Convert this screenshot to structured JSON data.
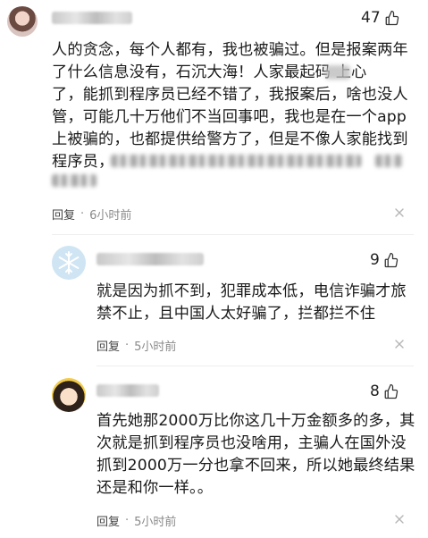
{
  "comments": [
    {
      "likes": "47",
      "lines": [
        "人的贪念，每个人都有，我也被骗过。但是报案两年",
        "了什么信息没有，石沉大海！人家最起码   上心",
        "了，能抓到程序员已经不错了，我报案后，啥也没人",
        "管，可能几十万他们不当回事吧，我也是在一个app",
        "上被骗的，也都提供给警方了，但是不像人家能找到",
        "程序员，"
      ],
      "reply_label": "回复",
      "time": "6小时前"
    },
    {
      "likes": "9",
      "lines": [
        "就是因为抓不到，犯罪成本低，电信诈骗才旅",
        "禁不止，且中国人太好骗了，拦都拦不住"
      ],
      "reply_label": "回复",
      "time": "5小时前"
    },
    {
      "likes": "8",
      "lines": [
        "首先她那2000万比你这几十万金额多的多，其",
        "次就是抓到程序员也没啥用，主骗人在国外没",
        "抓到2000万一分也拿不回来，所以她最终结果",
        "还是和你一样。。"
      ],
      "reply_label": "回复",
      "time": "5小时前"
    }
  ],
  "dot_separator": "·",
  "icons": {
    "like": "thumbs-up-icon",
    "more": "close-icon"
  }
}
